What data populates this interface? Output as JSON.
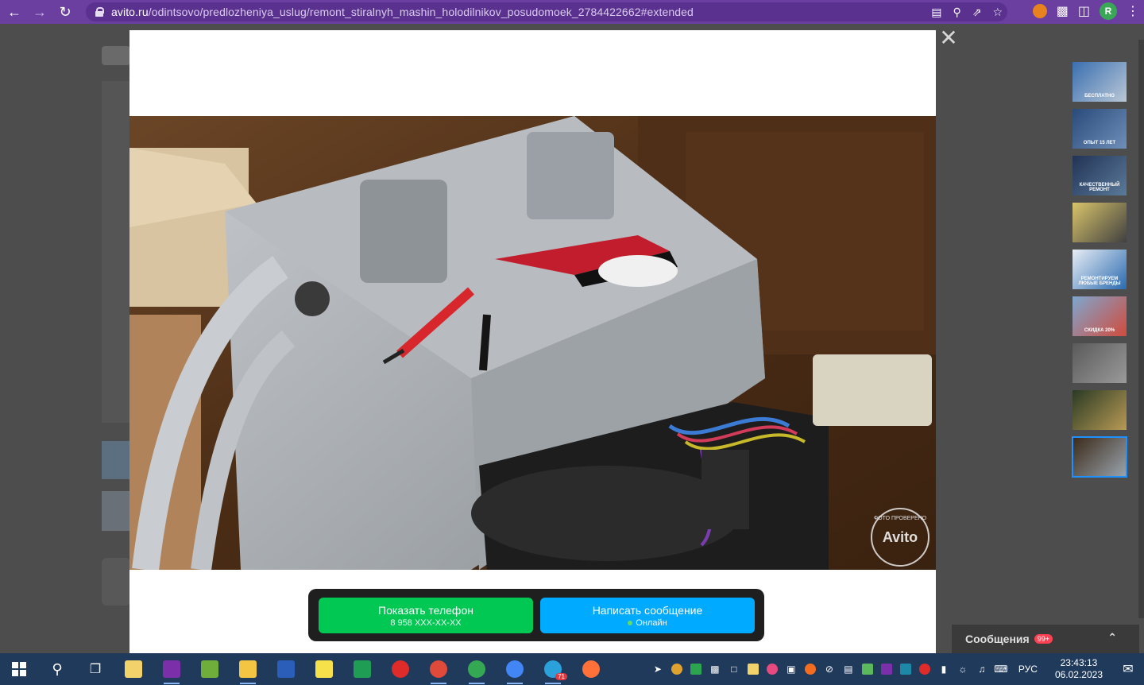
{
  "browser": {
    "url_host": "avito.ru",
    "url_path": "/odintsovo/predlozheniya_uslug/remont_stiralnyh_mashin_holodilnikov_posudomoek_2784422662#extended",
    "profile_initial": "R"
  },
  "modal": {
    "phone_button": {
      "label": "Показать телефон",
      "sub": "8 958 XXX-XX-XX"
    },
    "message_button": {
      "label": "Написать сообщение",
      "sub": "Онлайн"
    },
    "watermark_brand": "Avito",
    "watermark_ring": "ФОТО ПРОВЕРЕНО"
  },
  "thumbnails": [
    {
      "caption": "БЕСПЛАТНО",
      "colors": [
        "#3a6fb0",
        "#b9c7d6"
      ]
    },
    {
      "caption": "ОПЫТ 15 ЛЕТ",
      "colors": [
        "#2a4a7a",
        "#6d8fb8"
      ]
    },
    {
      "caption": "КАЧЕСТВЕННЫЙ РЕМОНТ",
      "colors": [
        "#223355",
        "#5a7a9a"
      ]
    },
    {
      "caption": "",
      "colors": [
        "#d9c46a",
        "#404040"
      ]
    },
    {
      "caption": "РЕМОНТИРУЕМ ЛЮБЫЕ БРЕНДЫ",
      "colors": [
        "#e8eef5",
        "#2a6ab0"
      ]
    },
    {
      "caption": "СКИДКА 20%",
      "colors": [
        "#7ea7cf",
        "#d14b3c"
      ]
    },
    {
      "caption": "",
      "colors": [
        "#5a5a5a",
        "#9a9a9a"
      ]
    },
    {
      "caption": "",
      "colors": [
        "#2a3a24",
        "#b89a55"
      ]
    },
    {
      "caption": "",
      "colors": [
        "#3a2818",
        "#9aa5ad"
      ]
    }
  ],
  "messages_panel": {
    "title": "Сообщения",
    "badge": "99+"
  },
  "taskbar": {
    "lang": "РУС",
    "time": "23:43:13",
    "date": "06.02.2023",
    "telegram_badge": "71"
  }
}
